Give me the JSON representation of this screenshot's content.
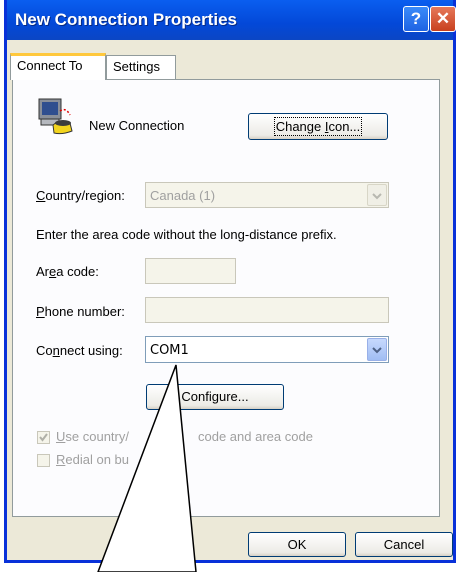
{
  "window": {
    "title": "New Connection Properties"
  },
  "titlebar_buttons": {
    "help": "?",
    "close": "✕"
  },
  "tabs": [
    {
      "label": "Connect To",
      "active": true
    },
    {
      "label": "Settings",
      "active": false
    }
  ],
  "connection": {
    "name": "New Connection",
    "change_icon_label": "Change Icon..."
  },
  "country": {
    "label": "Country/region:",
    "value": "Canada (1)"
  },
  "instructions": "Enter the area code without the long-distance prefix.",
  "area_code": {
    "label": "Area code:",
    "value": ""
  },
  "phone_number": {
    "label": "Phone number:",
    "value": ""
  },
  "connect_using": {
    "label": "Connect using:",
    "value": "COM1"
  },
  "configure_label": "Configure...",
  "use_country_code": {
    "label_visible_start": "Use country/",
    "label_visible_end": "code and area code",
    "checked": true
  },
  "redial": {
    "label_visible": "Redial on bu"
  },
  "footer": {
    "ok_label": "OK",
    "cancel_label": "Cancel"
  },
  "colors": {
    "titlebar": "#0348d8",
    "dialog_bg": "#ece9d8",
    "tab_highlight": "#ffc83c",
    "close_button": "#c8401e"
  },
  "icons": {
    "connection": "phone-modem-icon",
    "dropdown": "chevron-down-icon",
    "help": "question-mark-icon",
    "close": "close-icon"
  }
}
